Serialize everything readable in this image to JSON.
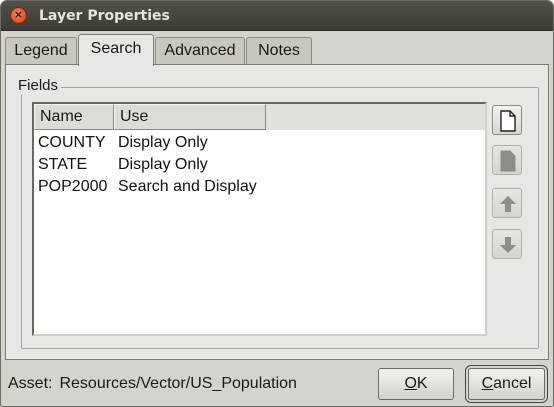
{
  "window": {
    "title": "Layer Properties",
    "close_icon": "close-icon"
  },
  "tabs": [
    {
      "label": "Legend",
      "active": false
    },
    {
      "label": "Search",
      "active": true
    },
    {
      "label": "Advanced",
      "active": false
    },
    {
      "label": "Notes",
      "active": false
    }
  ],
  "fields": {
    "group_label": "Fields",
    "columns": [
      "Name",
      "Use"
    ],
    "rows": [
      {
        "name": "COUNTY",
        "use": "Display Only"
      },
      {
        "name": "STATE",
        "use": "Display Only"
      },
      {
        "name": "POP2000",
        "use": "Search and Display"
      }
    ],
    "tools": [
      {
        "icon": "new-document-icon",
        "enabled": true
      },
      {
        "icon": "document-icon",
        "enabled": false
      },
      {
        "icon": "arrow-up-icon",
        "enabled": false
      },
      {
        "icon": "arrow-down-icon",
        "enabled": false
      }
    ]
  },
  "footer": {
    "asset_label": "Asset:",
    "asset_path": "Resources/Vector/US_Population",
    "ok_mnemonic": "O",
    "ok_rest": "K",
    "cancel_mnemonic": "C",
    "cancel_rest": "ancel"
  },
  "colors": {
    "titlebar": "#45433d",
    "close_button": "#e05a2c",
    "window_bg": "#d4d2cc",
    "page_bg": "#e7e6e2"
  }
}
